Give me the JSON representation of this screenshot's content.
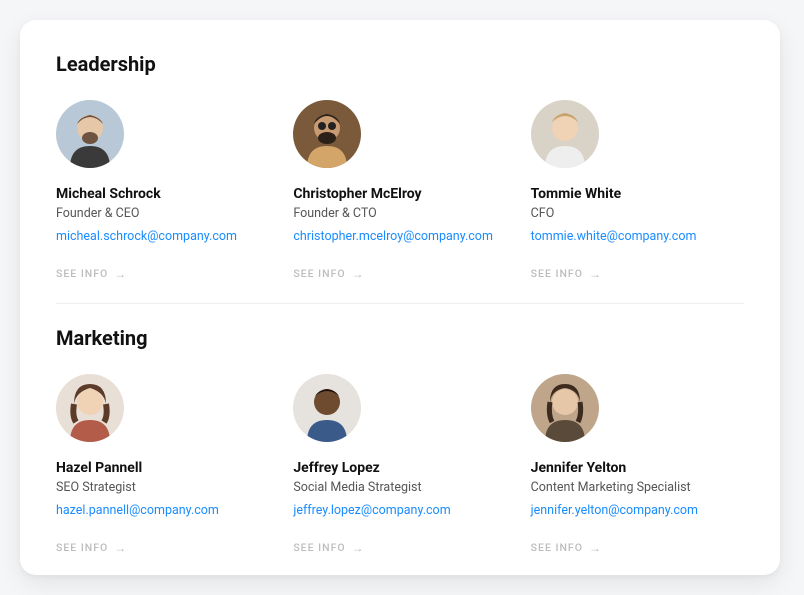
{
  "sections": [
    {
      "title": "Leadership",
      "members": [
        {
          "name": "Micheal Schrock",
          "role": "Founder & CEO",
          "email": "micheal.schrock@company.com",
          "avatar_bg": "#b8c8d6",
          "skin": "#e6c7a8",
          "hair": "#6d5340"
        },
        {
          "name": "Christopher McElroy",
          "role": "Founder & CTO",
          "email": "christopher.mcelroy@company.com",
          "avatar_bg": "#7a5a3a",
          "skin": "#c99b72",
          "hair": "#2b2118"
        },
        {
          "name": "Tommie White",
          "role": "CFO",
          "email": "tommie.white@company.com",
          "avatar_bg": "#d9d2c7",
          "skin": "#f0d2b5",
          "hair": "#c7a36b"
        }
      ]
    },
    {
      "title": "Marketing",
      "members": [
        {
          "name": "Hazel Pannell",
          "role": "SEO Strategist",
          "email": "hazel.pannell@company.com",
          "avatar_bg": "#e8dfd6",
          "skin": "#f0d2b5",
          "hair": "#5c3b28"
        },
        {
          "name": "Jeffrey Lopez",
          "role": "Social Media Strategist",
          "email": "jeffrey.lopez@company.com",
          "avatar_bg": "#e6e2de",
          "skin": "#6e4a2e",
          "hair": "#1d1410"
        },
        {
          "name": "Jennifer Yelton",
          "role": "Content Marketing Specialist",
          "email": "jennifer.yelton@company.com",
          "avatar_bg": "#bfa68a",
          "skin": "#e6c7a8",
          "hair": "#3d2b1f"
        }
      ]
    }
  ],
  "see_info_label": "SEE INFO"
}
